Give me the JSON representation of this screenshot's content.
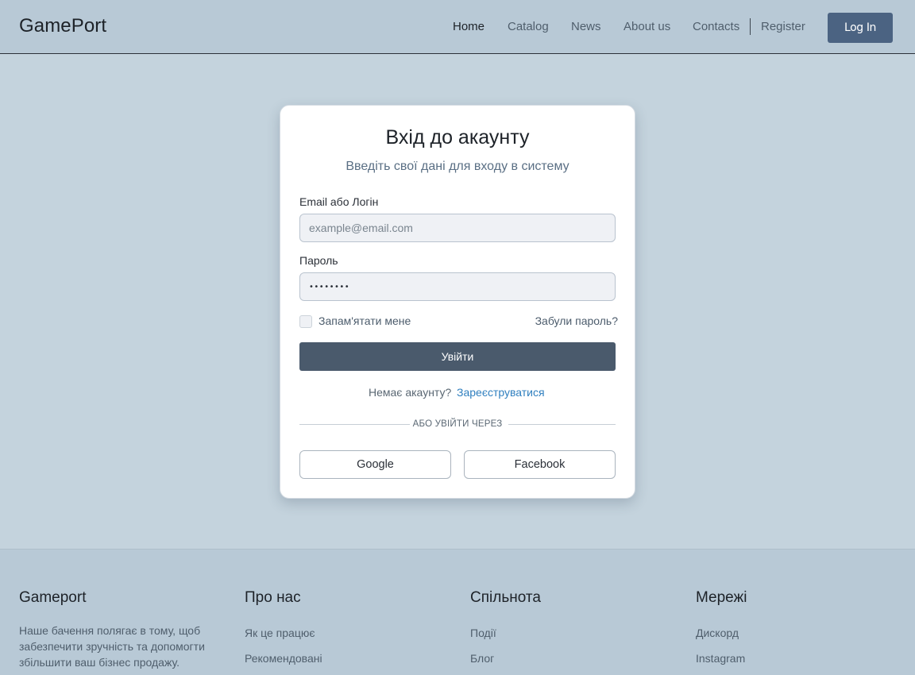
{
  "header": {
    "logo": "GamePort",
    "nav": [
      {
        "label": "Home",
        "active": true
      },
      {
        "label": "Catalog",
        "active": false
      },
      {
        "label": "News",
        "active": false
      },
      {
        "label": "About us",
        "active": false
      },
      {
        "label": "Contacts",
        "active": false
      }
    ],
    "register_label": "Register",
    "login_label": "Log In"
  },
  "login_card": {
    "title": "Вхід до акаунту",
    "subtitle": "Введіть свої дані для входу в систему",
    "email_label": "Email або Логін",
    "email_placeholder": "example@email.com",
    "password_label": "Пароль",
    "password_value": "••••••••",
    "remember_label": "Запам'ятати мене",
    "remember_checked": false,
    "forgot_link": "Забули пароль?",
    "submit_label": "Увійти",
    "no_account_text": "Немає акаунту?",
    "register_link": "Зареєструватися",
    "divider_text": "АБО УВІЙТИ ЧЕРЕЗ",
    "social": [
      {
        "label": "Google"
      },
      {
        "label": "Facebook"
      }
    ]
  },
  "footer": {
    "brand": {
      "title": "Gameport",
      "description": "Наше бачення полягає в тому, щоб забезпечити зручність та допомогти збільшити ваш бізнес продажу."
    },
    "columns": [
      {
        "title": "Про нас",
        "links": [
          "Як це працює",
          "Рекомендовані"
        ]
      },
      {
        "title": "Спільнота",
        "links": [
          "Події",
          "Блог"
        ]
      },
      {
        "title": "Мережі",
        "links": [
          "Дискорд",
          "Instagram"
        ]
      }
    ]
  },
  "colors": {
    "page_bg": "#c4d3dd",
    "header_bg": "#b8c9d6",
    "primary_button": "#4b6382",
    "submit_button": "#4a5a6c",
    "link_accent": "#2f7fbf"
  }
}
